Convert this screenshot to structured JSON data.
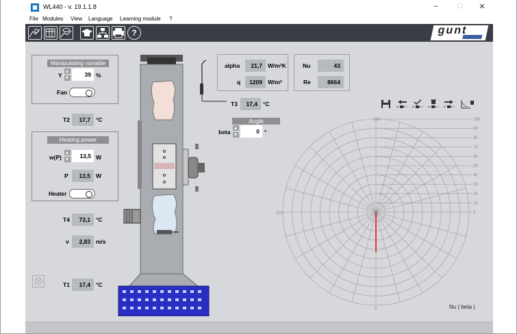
{
  "window": {
    "title": "WL440 - v. 19.1.1.8",
    "minimize": "–",
    "maximize": "□",
    "close": "✕"
  },
  "menu": [
    "File",
    "Modules",
    "View",
    "Language",
    "Learning module",
    "?"
  ],
  "toolbar_icons": [
    "chart-icon",
    "table-icon",
    "eye-chart-icon",
    "mortarboard-icon",
    "network-icon",
    "printer-icon",
    "help-icon"
  ],
  "logo": {
    "text": "gunt",
    "subtext": "HAMBURG"
  },
  "manip": {
    "title": "Manipulating variable",
    "y_label": "Y",
    "y_value": "39",
    "y_unit": "%",
    "fan_label": "Fan"
  },
  "t2": {
    "label": "T2",
    "value": "17,7",
    "unit": "°C"
  },
  "heat": {
    "title": "Heating power",
    "wp_label": "w(P)",
    "wp_value": "13,5",
    "wp_unit": "W",
    "p_label": "P",
    "p_value": "13,5",
    "p_unit": "W",
    "heater_label": "Heater"
  },
  "t4": {
    "label": "T4",
    "value": "73,1",
    "unit": "°C"
  },
  "v": {
    "label": "v",
    "value": "2,83",
    "unit": "m/s"
  },
  "t1": {
    "label": "T1",
    "value": "17,4",
    "unit": "°C"
  },
  "alpha": {
    "label": "alpha",
    "value": "21,7",
    "unit": "W/m²K"
  },
  "q": {
    "label": "q",
    "value": "1209",
    "unit": "W/m²"
  },
  "nu": {
    "label": "Nu",
    "value": "43"
  },
  "re": {
    "label": "Re",
    "value": "8664"
  },
  "t3": {
    "label": "T3",
    "value": "17,4",
    "unit": "°C"
  },
  "angle": {
    "title": "Angle",
    "beta_label": "beta",
    "beta_value": "0",
    "beta_unit": "°"
  },
  "plot_icons": [
    "save-icon",
    "arrow-left-store-icon",
    "check-store-icon",
    "delete-store-icon",
    "arrow-right-store-icon",
    "delete-chart-icon"
  ],
  "polar": {
    "label_top": "180",
    "label_left": "270",
    "label_bottom": "0",
    "radial_labels": [
      "100",
      "90",
      "80",
      "70",
      "60",
      "50",
      "40",
      "30",
      "20",
      "10",
      "0"
    ],
    "legend": "Nu ( beta )",
    "line_color": "#e00000",
    "nu_value": 43
  }
}
